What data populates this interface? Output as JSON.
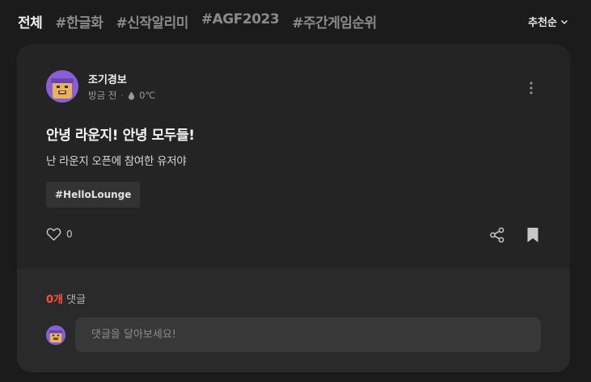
{
  "tabs": [
    {
      "label": "전체",
      "active": true
    },
    {
      "label": "#한글화"
    },
    {
      "label": "#신작알리미"
    },
    {
      "label": "#AGF2023"
    },
    {
      "label": "#주간게임순위"
    }
  ],
  "sort": {
    "label": "추천순",
    "icon": "chevron-down-icon"
  },
  "post": {
    "author": "조기경보",
    "time": "방금 전",
    "temperature": "0℃",
    "title": "안녕 라운지! 안녕 모두들!",
    "body": "난 라운지 오픈에 참여한 유저야",
    "tag": "#HelloLounge",
    "likes": "0"
  },
  "comments": {
    "count": "0개",
    "label": "댓글",
    "placeholder": "댓글을 달아보세요!"
  },
  "colors": {
    "accent": "#ff4f3a",
    "avatar_bg": "#8a5fd6",
    "card_bg": "#242424"
  }
}
